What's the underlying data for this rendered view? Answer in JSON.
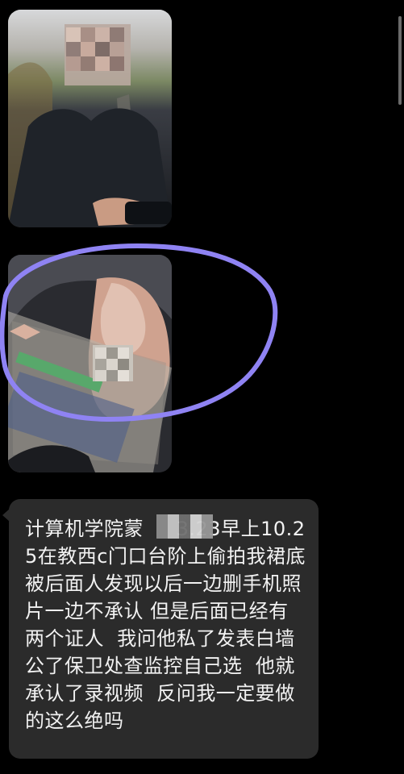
{
  "message": {
    "text": "计算机学院蒙     3.23早上10.25在教西c门口台阶上偷拍我裙底 被后面人发现以后一边删手机照片一边不承认 但是后面已经有两个证人  我问他私了发表白墙公了保卫处查监控自己选  他就承认了录视频  反问我一定要做的这么绝吗"
  },
  "colors": {
    "background": "#000000",
    "bubble": "#2b2b2b",
    "text": "#f2f2f2",
    "annotation_circle": "#8f83f3"
  },
  "icons": {
    "scrollbar": "scrollbar"
  }
}
